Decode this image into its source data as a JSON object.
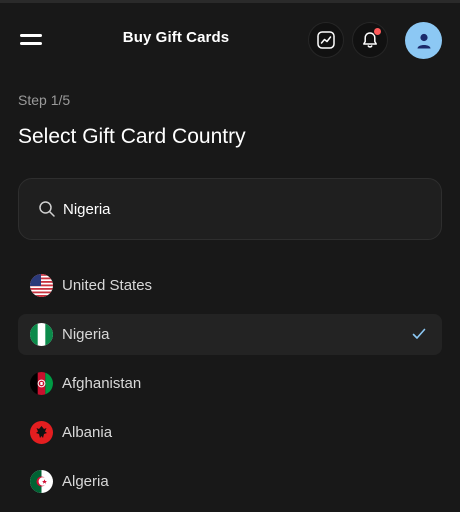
{
  "header": {
    "title": "Buy Gift Cards",
    "icons": {
      "menu": "hamburger-menu-icon",
      "chart": "trend-chart-icon",
      "bell": "bell-icon",
      "avatar": "user-avatar-icon"
    },
    "has_notification": true
  },
  "step": {
    "label": "Step 1/5"
  },
  "page": {
    "title": "Select Gift Card Country"
  },
  "search": {
    "value": "Nigeria",
    "icon": "search-icon"
  },
  "countries": [
    {
      "name": "United States",
      "flag": "us-flag-icon",
      "selected": false
    },
    {
      "name": "Nigeria",
      "flag": "nigeria-flag-icon",
      "selected": true
    },
    {
      "name": "Afghanistan",
      "flag": "afghanistan-flag-icon",
      "selected": false
    },
    {
      "name": "Albania",
      "flag": "albania-flag-icon",
      "selected": false
    },
    {
      "name": "Algeria",
      "flag": "algeria-flag-icon",
      "selected": false
    }
  ],
  "colors": {
    "background": "#181818",
    "selected_row": "#232323",
    "accent": "#8cc8f4",
    "notification": "#ff5a5a"
  }
}
